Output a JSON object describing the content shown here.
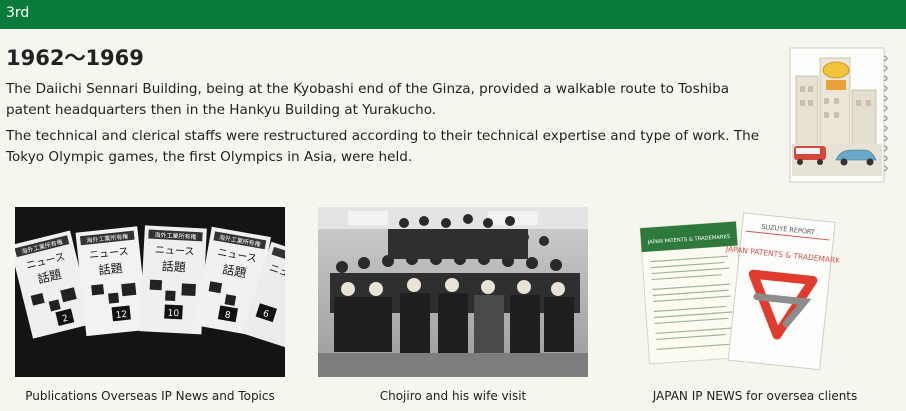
{
  "header": {
    "label": "3rd",
    "color": "#0a7a3a"
  },
  "section": {
    "title": "1962～1969",
    "paragraphs": [
      "The Daiichi Sennari Building, being at the Kyobashi end of the Ginza, provided a walkable route to Toshiba patent headquarters then in the Hankyu Building at Yurakucho.",
      "The technical and clerical staffs were restructured according to their technical expertise and type of work. The Tokyo Olympic games, the first Olympics in Asia, were held."
    ]
  },
  "illustration": {
    "icon": "street-scene-sketch-notebook"
  },
  "photos": [
    {
      "caption": "Publications Overseas IP News and Topics",
      "image_text": {
        "masthead": "海外工業所有権",
        "news": "ニュース",
        "topics": "話題",
        "numbers": [
          "2",
          "12",
          "10",
          "8",
          "6"
        ]
      }
    },
    {
      "caption": "Chojiro and his wife visit"
    },
    {
      "caption": "JAPAN IP NEWS for oversea clients",
      "image_text": {
        "sheet_title": "JAPAN PATENTS & TRADEMARKS",
        "report_brand": "SUZUYE REPORT",
        "report_title": "JAPAN PATENTS & TRADEMARKS"
      }
    }
  ]
}
